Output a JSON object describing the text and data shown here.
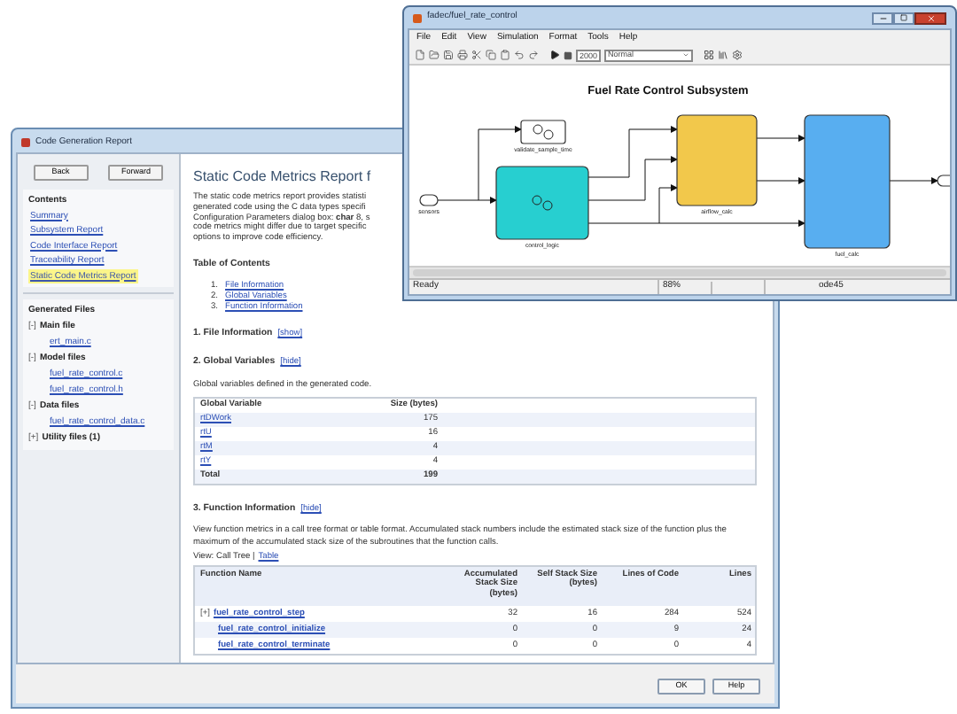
{
  "report_window": {
    "title": "Code Generation Report",
    "nav_buttons": [
      "Back",
      "Forward"
    ],
    "contents_heading": "Contents",
    "contents": [
      {
        "label": "Summary",
        "selected": false
      },
      {
        "label": "Subsystem Report",
        "selected": false
      },
      {
        "label": "Code Interface Report",
        "selected": false
      },
      {
        "label": "Traceability Report",
        "selected": false
      },
      {
        "label": "Static Code Metrics Report",
        "selected": true
      }
    ],
    "files_heading": "Generated Files",
    "file_groups": [
      {
        "toggle": "[-]",
        "label": "Main file",
        "files": [
          "ert_main.c"
        ]
      },
      {
        "toggle": "[-]",
        "label": "Model files",
        "files": [
          "fuel_rate_control.c",
          "fuel_rate_control.h"
        ]
      },
      {
        "toggle": "[-]",
        "label": "Data files",
        "files": [
          "fuel_rate_control_data.c"
        ]
      },
      {
        "toggle": "[+]",
        "label": "Utility files (1)"
      }
    ],
    "heading": "Static Code Metrics Report f",
    "intro": [
      "The static code metrics report provides statisti",
      "generated code using the C data types specifi",
      "Configuration Parameters dialog box: **char** 8, s",
      "code metrics might differ due to target specific",
      "options to improve code efficiency."
    ],
    "toc_heading": "Table of Contents",
    "toc": [
      {
        "number": "1.",
        "label": "File Information"
      },
      {
        "number": "2.",
        "label": "Global Variables"
      },
      {
        "number": "3.",
        "label": "Function Information"
      }
    ],
    "file_info": {
      "heading": "1. File Information",
      "toggle": "[show]"
    },
    "global_vars": {
      "heading": "2. Global Variables",
      "toggle": "[hide]",
      "description": "Global variables defined in the generated code.",
      "columns": [
        "Global Variable",
        "Size (bytes)"
      ],
      "rows": [
        {
          "kind": "item",
          "name": "rtDWork",
          "size": "175"
        },
        {
          "kind": "item",
          "name": "rtU",
          "size": "16"
        },
        {
          "kind": "item",
          "name": "rtM",
          "size": "4"
        },
        {
          "kind": "item",
          "name": "rtY",
          "size": "4"
        },
        {
          "kind": "total",
          "name": "Total",
          "size": "199"
        }
      ]
    },
    "function_info": {
      "heading": "3. Function Information",
      "toggle": "[hide]",
      "description": "View function metrics in a call tree format or table format. Accumulated stack numbers include the estimated stack size of the function plus the maximum of the accumulated stack size of the subroutines that the function calls.",
      "view_label": "View: Call Tree |",
      "view_link": "Table",
      "columns": [
        "Function Name",
        "Accumulated Stack Size (bytes)",
        "Self Stack Size (bytes)",
        "Lines of Code",
        "Lines"
      ],
      "rows": [
        {
          "toggle": "[+]",
          "name": "fuel_rate_control_step",
          "values": [
            "32",
            "16",
            "284",
            "524"
          ]
        },
        {
          "name": "fuel_rate_control_initialize",
          "values": [
            "0",
            "0",
            "9",
            "24"
          ]
        },
        {
          "name": "fuel_rate_control_terminate",
          "values": [
            "0",
            "0",
            "0",
            "4"
          ]
        }
      ]
    },
    "buttons": [
      "OK",
      "Help"
    ]
  },
  "model_window": {
    "title": "fadec/fuel_rate_control",
    "menu": [
      "File",
      "Edit",
      "View",
      "Simulation",
      "Format",
      "Tools",
      "Help"
    ],
    "stop_time": "2000",
    "sim_mode": "Normal",
    "diagram_title": "Fuel Rate Control Subsystem",
    "blocks": [
      {
        "kind": "inport",
        "name": "sensors"
      },
      {
        "kind": "chart",
        "name": "validate_sample_time",
        "color": "#ffffff"
      },
      {
        "kind": "subsystem",
        "name": "control_logic",
        "color": "#27cfd0"
      },
      {
        "kind": "subsystem",
        "name": "airflow_calc",
        "color": "#f2c84b"
      },
      {
        "kind": "subsystem",
        "name": "fuel_calc",
        "color": "#58aef0"
      }
    ],
    "status": {
      "state": "Ready",
      "zoom": "88%",
      "solver": "ode45"
    }
  }
}
